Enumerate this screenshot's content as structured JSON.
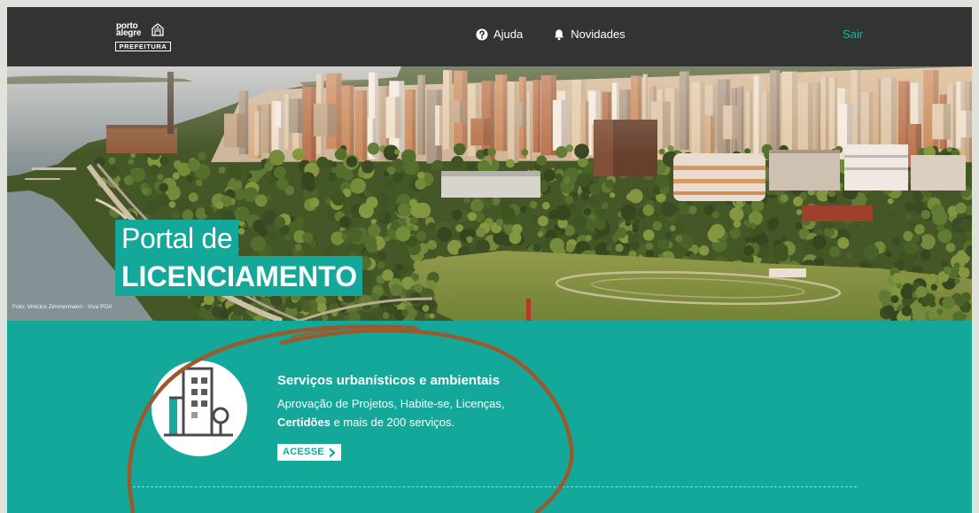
{
  "header": {
    "logo": {
      "line1": "porto",
      "line2": "alegre",
      "badge": "PREFEITURA",
      "icon": "city-crest-icon"
    },
    "nav": [
      {
        "label": "Ajuda",
        "icon": "help-circle-icon"
      },
      {
        "label": "Novidades",
        "icon": "bell-icon"
      }
    ],
    "logout_label": "Sair"
  },
  "hero": {
    "title_line1": "Portal de",
    "title_line2": "LICENCIAMENTO",
    "photo_credit": "Foto: Vinicius Zimmermann - Viva POA"
  },
  "services": {
    "cards": [
      {
        "icon": "building-map-pin-icon",
        "title": "Serviços urbanísticos e ambientais",
        "description_line1": "Aprovação de Projetos, Habite-se, Licenças,",
        "description_bold": "Certidões",
        "description_rest": " e mais de 200 serviços.",
        "cta_label": "ACESSE",
        "cta_icon": "chevron-right-icon"
      }
    ]
  },
  "colors": {
    "frame": "#dfe3dc",
    "header_bg": "#333333",
    "accent": "#14a89a",
    "logout_link": "#1ab3a3",
    "annotation_stroke": "#9b5a2d"
  }
}
